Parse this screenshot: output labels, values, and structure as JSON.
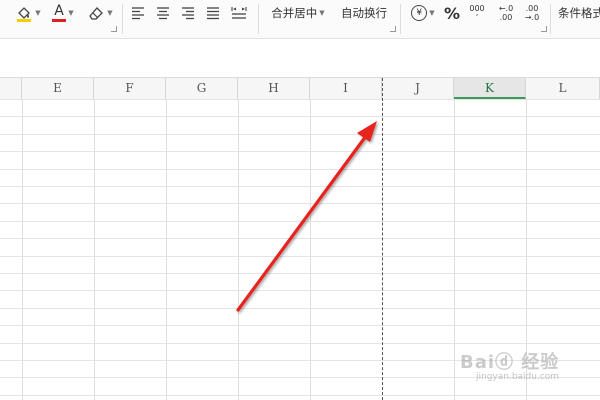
{
  "ribbon": {
    "merge_center_label": "合并居中",
    "wrap_text_label": "自动换行",
    "percent_symbol": "%",
    "thousands_top": "000",
    "thousands_bottom": "ʼ",
    "inc_decimal_top": "←.0",
    "inc_decimal_bottom": ".00",
    "dec_decimal_top": ".00",
    "dec_decimal_bottom": "→.0",
    "conditional_format_label": "条件格式",
    "font_color_letter": "A",
    "fill_color_accent": "#f5d000",
    "font_color_accent": "#e02020",
    "currency_symbol": "¥"
  },
  "columns": [
    "E",
    "F",
    "G",
    "H",
    "I",
    "J",
    "K",
    "L"
  ],
  "selected_column": "K",
  "watermark": {
    "text": "Baiⓓ 经验",
    "url": "jingyan.baidu.com"
  },
  "colors": {
    "arrow": "#e8231f",
    "selected_header_accent": "#3a9a5a"
  }
}
